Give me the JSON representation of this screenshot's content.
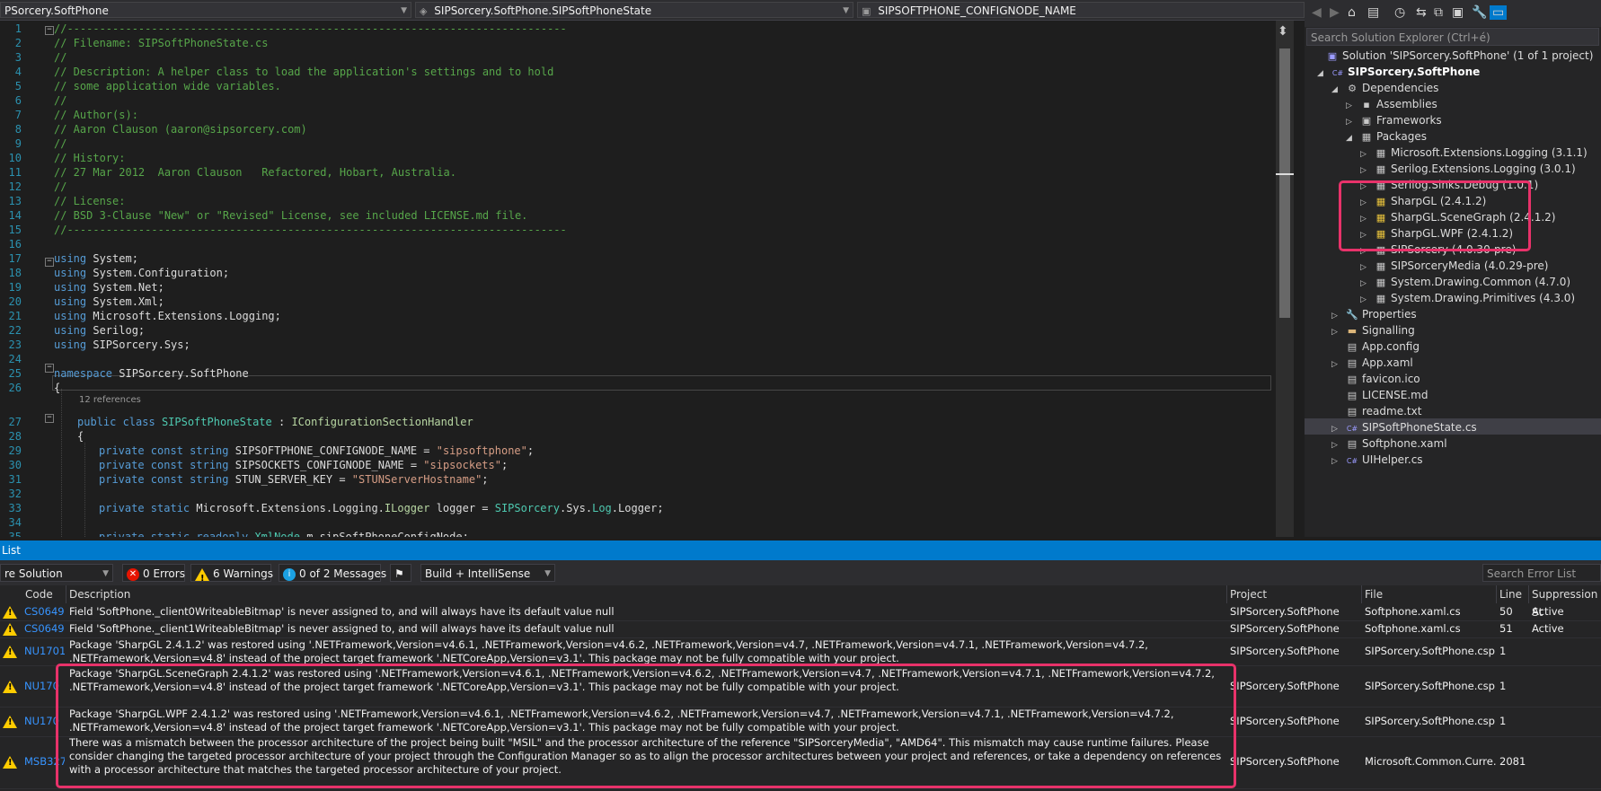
{
  "navbar": {
    "project": "PSorcery.SoftPhone",
    "type": "SIPSorcery.SoftPhone.SIPSoftPhoneState",
    "member": "SIPSOFTPHONE_CONFIGNODE_NAME"
  },
  "editor": {
    "line_numbers": [
      "1",
      "2",
      "3",
      "4",
      "5",
      "6",
      "7",
      "8",
      "9",
      "10",
      "11",
      "12",
      "13",
      "14",
      "15",
      "16",
      "17",
      "18",
      "19",
      "20",
      "21",
      "22",
      "23",
      "24",
      "25",
      "26",
      "27",
      "28",
      "29",
      "30",
      "31",
      "32",
      "33",
      "34",
      "35"
    ],
    "codelens": "12 references",
    "comments": [
      "//-----------------------------------------------------------------------------",
      "// Filename: SIPSoftPhoneState.cs",
      "//",
      "// Description: A helper class to load the application's settings and to hold",
      "// some application wide variables.",
      "//",
      "// Author(s):",
      "// Aaron Clauson (aaron@sipsorcery.com)",
      "//",
      "// History:",
      "// 27 Mar 2012  Aaron Clauson   Refactored, Hobart, Australia.",
      "//",
      "// License:",
      "// BSD 3-Clause \"New\" or \"Revised\" License, see included LICENSE.md file.",
      "//-----------------------------------------------------------------------------"
    ],
    "usings": [
      "System;",
      "System.Configuration;",
      "System.Net;",
      "System.Xml;",
      "Microsoft.Extensions.Logging;",
      "Serilog;",
      "SIPSorcery.Sys;"
    ],
    "kw_using": "using",
    "kw_namespace": "namespace",
    "namespace_name": "SIPSorcery.SoftPhone",
    "brace_open": "{",
    "class_line": {
      "mods": "public class",
      "name": "SIPSoftPhoneState",
      "sep": " : ",
      "iface": "IConfigurationSectionHandler"
    },
    "consts": [
      {
        "mods": "private const",
        "type": "string",
        "name": "SIPSOFTPHONE_CONFIGNODE_NAME = ",
        "value": "\"sipsoftphone\"",
        "end": ";"
      },
      {
        "mods": "private const",
        "type": "string",
        "name": "SIPSOCKETS_CONFIGNODE_NAME = ",
        "value": "\"sipsockets\"",
        "end": ";"
      },
      {
        "mods": "private const",
        "type": "string",
        "name": "STUN_SERVER_KEY = ",
        "value": "\"STUNServerHostname\"",
        "end": ";"
      }
    ],
    "logger_line": {
      "mods": "private static",
      "type": "Microsoft.Extensions.Logging.",
      "itype": "ILogger",
      "rest": " logger = ",
      "cls": "SIPSorcery",
      "mid": ".Sys.",
      "cls2": "Log",
      "tail": ".Logger;"
    },
    "xml_line": {
      "mods": "private static readonly",
      "type": "XmlNode",
      "rest": " m_sipSoftPhoneConfigNode;"
    }
  },
  "solution_explorer": {
    "search_placeholder": "Search Solution Explorer (Ctrl+é)",
    "nodes": [
      {
        "label": "Solution 'SIPSorcery.SoftPhone' (1 of 1 project)",
        "icon": "solution-icon",
        "glyph": "▣"
      },
      {
        "label": "SIPSorcery.SoftPhone",
        "icon": "csharp-project-icon",
        "glyph": "C#"
      },
      {
        "label": "Dependencies",
        "icon": "dependencies-icon",
        "glyph": "⚙"
      },
      {
        "label": "Assemblies",
        "icon": "assemblies-icon",
        "glyph": "▪"
      },
      {
        "label": "Frameworks",
        "icon": "frameworks-icon",
        "glyph": "▣"
      },
      {
        "label": "Packages",
        "icon": "packages-icon",
        "glyph": "▦"
      },
      {
        "label": "Microsoft.Extensions.Logging (3.1.1)",
        "icon": "package-icon",
        "glyph": "▦"
      },
      {
        "label": "Serilog.Extensions.Logging (3.0.1)",
        "icon": "package-icon",
        "glyph": "▦"
      },
      {
        "label": "Serilog.Sinks.Debug (1.0.1)",
        "icon": "package-icon",
        "glyph": "▦"
      },
      {
        "label": "SharpGL (2.4.1.2)",
        "icon": "package-warning-icon",
        "glyph": "▦"
      },
      {
        "label": "SharpGL.SceneGraph (2.4.1.2)",
        "icon": "package-warning-icon",
        "glyph": "▦"
      },
      {
        "label": "SharpGL.WPF (2.4.1.2)",
        "icon": "package-warning-icon",
        "glyph": "▦"
      },
      {
        "label": "SIPSorcery (4.0.30-pre)",
        "icon": "package-icon",
        "glyph": "▦"
      },
      {
        "label": "SIPSorceryMedia (4.0.29-pre)",
        "icon": "package-icon",
        "glyph": "▦"
      },
      {
        "label": "System.Drawing.Common (4.7.0)",
        "icon": "package-icon",
        "glyph": "▦"
      },
      {
        "label": "System.Drawing.Primitives (4.3.0)",
        "icon": "package-icon",
        "glyph": "▦"
      },
      {
        "label": "Properties",
        "icon": "wrench-icon",
        "glyph": "🔧"
      },
      {
        "label": "Signalling",
        "icon": "folder-icon",
        "glyph": "▬"
      },
      {
        "label": "App.config",
        "icon": "config-file-icon",
        "glyph": "▤"
      },
      {
        "label": "App.xaml",
        "icon": "xaml-file-icon",
        "glyph": "▤"
      },
      {
        "label": "favicon.ico",
        "icon": "image-file-icon",
        "glyph": "▤"
      },
      {
        "label": "LICENSE.md",
        "icon": "markdown-file-icon",
        "glyph": "▤"
      },
      {
        "label": "readme.txt",
        "icon": "text-file-icon",
        "glyph": "▤"
      },
      {
        "label": "SIPSoftPhoneState.cs",
        "icon": "csharp-file-icon",
        "glyph": "C#"
      },
      {
        "label": "Softphone.xaml",
        "icon": "xaml-file-icon",
        "glyph": "▤"
      },
      {
        "label": "UIHelper.cs",
        "icon": "csharp-file-icon",
        "glyph": "C#"
      }
    ]
  },
  "error_list": {
    "title": "List",
    "scope": "re Solution",
    "errors": "0 Errors",
    "warnings": "6 Warnings",
    "messages": "0 of 2 Messages",
    "build_filter": "Build + IntelliSense",
    "search_placeholder": "Search Error List",
    "columns": {
      "code": "Code",
      "description": "Description",
      "project": "Project",
      "file": "File",
      "line": "Line",
      "suppression": "Suppression St"
    },
    "rows": [
      {
        "code": "CS0649",
        "description": "Field 'SoftPhone._client0WriteableBitmap' is never assigned to, and will always have its default value null",
        "project": "SIPSorcery.SoftPhone",
        "file": "Softphone.xaml.cs",
        "line": "50",
        "suppression": "Active"
      },
      {
        "code": "CS0649",
        "description": "Field 'SoftPhone._client1WriteableBitmap' is never assigned to, and will always have its default value null",
        "project": "SIPSorcery.SoftPhone",
        "file": "Softphone.xaml.cs",
        "line": "51",
        "suppression": "Active"
      },
      {
        "code": "NU1701",
        "description": "Package 'SharpGL 2.4.1.2' was restored using '.NETFramework,Version=v4.6.1, .NETFramework,Version=v4.6.2, .NETFramework,Version=v4.7, .NETFramework,Version=v4.7.1, .NETFramework,Version=v4.7.2, .NETFramework,Version=v4.8' instead of the project target framework '.NETCoreApp,Version=v3.1'. This package may not be fully compatible with your project.",
        "project": "SIPSorcery.SoftPhone",
        "file": "SIPSorcery.SoftPhone.csproj",
        "line": "1",
        "suppression": ""
      },
      {
        "code": "NU170",
        "description": "Package 'SharpGL.SceneGraph 2.4.1.2' was restored using '.NETFramework,Version=v4.6.1, .NETFramework,Version=v4.6.2, .NETFramework,Version=v4.7, .NETFramework,Version=v4.7.1, .NETFramework,Version=v4.7.2, .NETFramework,Version=v4.8' instead of the project target framework '.NETCoreApp,Version=v3.1'. This package may not be fully compatible with your project.",
        "project": "SIPSorcery.SoftPhone",
        "file": "SIPSorcery.SoftPhone.csproj",
        "line": "1",
        "suppression": ""
      },
      {
        "code": "NU170",
        "description": "Package 'SharpGL.WPF 2.4.1.2' was restored using '.NETFramework,Version=v4.6.1, .NETFramework,Version=v4.6.2, .NETFramework,Version=v4.7, .NETFramework,Version=v4.7.1, .NETFramework,Version=v4.7.2, .NETFramework,Version=v4.8' instead of the project target framework '.NETCoreApp,Version=v3.1'. This package may not be fully compatible with your project.",
        "project": "SIPSorcery.SoftPhone",
        "file": "SIPSorcery.SoftPhone.csproj",
        "line": "1",
        "suppression": ""
      },
      {
        "code": "MSB3270",
        "description": "There was a mismatch between the processor architecture of the project being built \"MSIL\" and the processor architecture of the reference \"SIPSorceryMedia\", \"AMD64\". This mismatch may cause runtime failures. Please consider changing the targeted processor architecture of your project through the Configuration Manager so as to align the processor architectures between your project and references, or take a dependency on references with a processor architecture that matches the targeted processor architecture of your project.",
        "project": "SIPSorcery.SoftPhone",
        "file": "Microsoft.Common.Curre...",
        "line": "2081",
        "suppression": ""
      }
    ]
  }
}
